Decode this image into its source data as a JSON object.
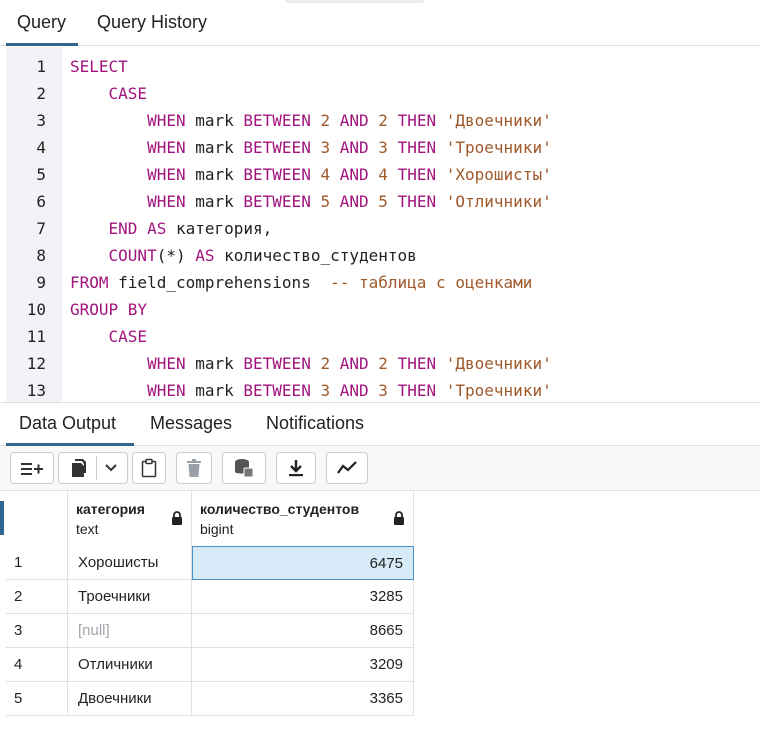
{
  "query_tabs": [
    {
      "label": "Query",
      "active": true
    },
    {
      "label": "Query History",
      "active": false
    }
  ],
  "editor": {
    "lines": [
      {
        "n": "1",
        "tokens": [
          {
            "t": "kw",
            "v": "SELECT"
          }
        ]
      },
      {
        "n": "2",
        "tokens": [
          {
            "t": "pl",
            "v": "    "
          },
          {
            "t": "kw",
            "v": "CASE"
          }
        ]
      },
      {
        "n": "3",
        "tokens": [
          {
            "t": "pl",
            "v": "        "
          },
          {
            "t": "kw",
            "v": "WHEN"
          },
          {
            "t": "pl",
            "v": " mark "
          },
          {
            "t": "kw",
            "v": "BETWEEN"
          },
          {
            "t": "pl",
            "v": " "
          },
          {
            "t": "num",
            "v": "2"
          },
          {
            "t": "pl",
            "v": " "
          },
          {
            "t": "kw",
            "v": "AND"
          },
          {
            "t": "pl",
            "v": " "
          },
          {
            "t": "num",
            "v": "2"
          },
          {
            "t": "pl",
            "v": " "
          },
          {
            "t": "kw",
            "v": "THEN"
          },
          {
            "t": "pl",
            "v": " "
          },
          {
            "t": "str",
            "v": "'Двоечники'"
          }
        ]
      },
      {
        "n": "4",
        "tokens": [
          {
            "t": "pl",
            "v": "        "
          },
          {
            "t": "kw",
            "v": "WHEN"
          },
          {
            "t": "pl",
            "v": " mark "
          },
          {
            "t": "kw",
            "v": "BETWEEN"
          },
          {
            "t": "pl",
            "v": " "
          },
          {
            "t": "num",
            "v": "3"
          },
          {
            "t": "pl",
            "v": " "
          },
          {
            "t": "kw",
            "v": "AND"
          },
          {
            "t": "pl",
            "v": " "
          },
          {
            "t": "num",
            "v": "3"
          },
          {
            "t": "pl",
            "v": " "
          },
          {
            "t": "kw",
            "v": "THEN"
          },
          {
            "t": "pl",
            "v": " "
          },
          {
            "t": "str",
            "v": "'Троечники'"
          }
        ]
      },
      {
        "n": "5",
        "tokens": [
          {
            "t": "pl",
            "v": "        "
          },
          {
            "t": "kw",
            "v": "WHEN"
          },
          {
            "t": "pl",
            "v": " mark "
          },
          {
            "t": "kw",
            "v": "BETWEEN"
          },
          {
            "t": "pl",
            "v": " "
          },
          {
            "t": "num",
            "v": "4"
          },
          {
            "t": "pl",
            "v": " "
          },
          {
            "t": "kw",
            "v": "AND"
          },
          {
            "t": "pl",
            "v": " "
          },
          {
            "t": "num",
            "v": "4"
          },
          {
            "t": "pl",
            "v": " "
          },
          {
            "t": "kw",
            "v": "THEN"
          },
          {
            "t": "pl",
            "v": " "
          },
          {
            "t": "str",
            "v": "'Хорошисты'"
          }
        ]
      },
      {
        "n": "6",
        "tokens": [
          {
            "t": "pl",
            "v": "        "
          },
          {
            "t": "kw",
            "v": "WHEN"
          },
          {
            "t": "pl",
            "v": " mark "
          },
          {
            "t": "kw",
            "v": "BETWEEN"
          },
          {
            "t": "pl",
            "v": " "
          },
          {
            "t": "num",
            "v": "5"
          },
          {
            "t": "pl",
            "v": " "
          },
          {
            "t": "kw",
            "v": "AND"
          },
          {
            "t": "pl",
            "v": " "
          },
          {
            "t": "num",
            "v": "5"
          },
          {
            "t": "pl",
            "v": " "
          },
          {
            "t": "kw",
            "v": "THEN"
          },
          {
            "t": "pl",
            "v": " "
          },
          {
            "t": "str",
            "v": "'Отличники'"
          }
        ]
      },
      {
        "n": "7",
        "tokens": [
          {
            "t": "pl",
            "v": "    "
          },
          {
            "t": "kw",
            "v": "END"
          },
          {
            "t": "pl",
            "v": " "
          },
          {
            "t": "kw",
            "v": "AS"
          },
          {
            "t": "pl",
            "v": " категория,"
          }
        ]
      },
      {
        "n": "8",
        "tokens": [
          {
            "t": "pl",
            "v": "    "
          },
          {
            "t": "kw",
            "v": "COUNT"
          },
          {
            "t": "pl",
            "v": "(*) "
          },
          {
            "t": "kw",
            "v": "AS"
          },
          {
            "t": "pl",
            "v": " количество_студентов"
          }
        ]
      },
      {
        "n": "9",
        "tokens": [
          {
            "t": "kw",
            "v": "FROM"
          },
          {
            "t": "pl",
            "v": " field_comprehensions  "
          },
          {
            "t": "cmt",
            "v": "-- таблица с оценками"
          }
        ]
      },
      {
        "n": "10",
        "tokens": [
          {
            "t": "kw",
            "v": "GROUP BY"
          }
        ]
      },
      {
        "n": "11",
        "tokens": [
          {
            "t": "pl",
            "v": "    "
          },
          {
            "t": "kw",
            "v": "CASE"
          }
        ]
      },
      {
        "n": "12",
        "tokens": [
          {
            "t": "pl",
            "v": "        "
          },
          {
            "t": "kw",
            "v": "WHEN"
          },
          {
            "t": "pl",
            "v": " mark "
          },
          {
            "t": "kw",
            "v": "BETWEEN"
          },
          {
            "t": "pl",
            "v": " "
          },
          {
            "t": "num",
            "v": "2"
          },
          {
            "t": "pl",
            "v": " "
          },
          {
            "t": "kw",
            "v": "AND"
          },
          {
            "t": "pl",
            "v": " "
          },
          {
            "t": "num",
            "v": "2"
          },
          {
            "t": "pl",
            "v": " "
          },
          {
            "t": "kw",
            "v": "THEN"
          },
          {
            "t": "pl",
            "v": " "
          },
          {
            "t": "str",
            "v": "'Двоечники'"
          }
        ]
      },
      {
        "n": "13",
        "tokens": [
          {
            "t": "pl",
            "v": "        "
          },
          {
            "t": "kw",
            "v": "WHEN"
          },
          {
            "t": "pl",
            "v": " mark "
          },
          {
            "t": "kw",
            "v": "BETWEEN"
          },
          {
            "t": "pl",
            "v": " "
          },
          {
            "t": "num",
            "v": "3"
          },
          {
            "t": "pl",
            "v": " "
          },
          {
            "t": "kw",
            "v": "AND"
          },
          {
            "t": "pl",
            "v": " "
          },
          {
            "t": "num",
            "v": "3"
          },
          {
            "t": "pl",
            "v": " "
          },
          {
            "t": "kw",
            "v": "THEN"
          },
          {
            "t": "pl",
            "v": " "
          },
          {
            "t": "str",
            "v": "'Троечники'"
          }
        ]
      }
    ]
  },
  "result_tabs": [
    {
      "label": "Data Output",
      "active": true
    },
    {
      "label": "Messages",
      "active": false
    },
    {
      "label": "Notifications",
      "active": false
    }
  ],
  "toolbar": {
    "icons": [
      "add-row-icon",
      "copy-icon",
      "chevron-down-icon",
      "paste-icon",
      "delete-icon",
      "save-data-icon",
      "download-icon",
      "graph-icon"
    ]
  },
  "grid": {
    "columns": [
      {
        "name": "категория",
        "type": "text"
      },
      {
        "name": "количество_студентов",
        "type": "bigint"
      }
    ],
    "rows": [
      {
        "n": "1",
        "category": "Хорошисты",
        "count": "6475",
        "null": false
      },
      {
        "n": "2",
        "category": "Троечники",
        "count": "3285",
        "null": false
      },
      {
        "n": "3",
        "category": "[null]",
        "count": "8665",
        "null": true
      },
      {
        "n": "4",
        "category": "Отличники",
        "count": "3209",
        "null": false
      },
      {
        "n": "5",
        "category": "Двоечники",
        "count": "3365",
        "null": false
      }
    ],
    "selected_cell": {
      "row": 0,
      "column": "count"
    }
  },
  "colors": {
    "keyword": "#a1147d",
    "literal": "#a0592b",
    "accent": "#326690",
    "selected_bg": "#d6ebf7"
  }
}
